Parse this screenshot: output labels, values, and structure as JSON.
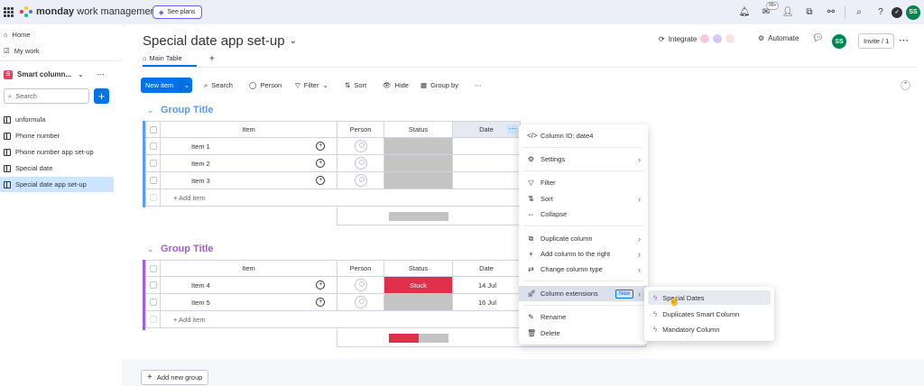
{
  "topbar": {
    "brand_bold": "monday",
    "brand_rest": " work management",
    "see_plans": "See plans",
    "notif_count": "99+",
    "user_initials": "SS"
  },
  "sidebar": {
    "home": "Home",
    "my_work": "My work",
    "workspace_initial": "S",
    "workspace_name": "Smart column...",
    "search_placeholder": "Search",
    "boards": [
      "unformula",
      "Phone number",
      "Phone number app set-up",
      "Special date",
      "Special date app set-up"
    ]
  },
  "board": {
    "title": "Special date app set-up",
    "main_tab": "Main Table",
    "integrate": "Integrate",
    "automate": "Automate",
    "invite": "Invite / 1",
    "user_initials": "SS"
  },
  "toolbar": {
    "new_item": "New item",
    "search": "Search",
    "person": "Person",
    "filter": "Filter",
    "sort": "Sort",
    "hide": "Hide",
    "group_by": "Group by"
  },
  "columns": {
    "item": "Item",
    "person": "Person",
    "status": "Status",
    "date": "Date"
  },
  "groups": [
    {
      "title": "Group Title",
      "color": "#579bfc",
      "items": [
        {
          "name": "Item 1",
          "status": "",
          "date": ""
        },
        {
          "name": "Item 2",
          "status": "",
          "date": ""
        },
        {
          "name": "Item 3",
          "status": "",
          "date": ""
        }
      ],
      "add_item": "+ Add item"
    },
    {
      "title": "Group Title",
      "color": "#a25ddc",
      "items": [
        {
          "name": "Item 4",
          "status": "Stuck",
          "date": "14 Jul"
        },
        {
          "name": "Item 5",
          "status": "",
          "date": "16 Jul"
        }
      ],
      "add_item": "+ Add item"
    }
  ],
  "column_menu": {
    "column_id": "Column ID: date4",
    "settings": "Settings",
    "filter": "Filter",
    "sort": "Sort",
    "collapse": "Collapse",
    "duplicate": "Duplicate column",
    "add_right": "Add column to the right",
    "change_type": "Change column type",
    "extensions": "Column extensions",
    "new_badge": "New",
    "rename": "Rename",
    "delete": "Delete"
  },
  "extensions_menu": [
    "Special Dates",
    "Duplicates Smart Column",
    "Mandatory Column"
  ],
  "add_new_group": "Add new group",
  "colors": {
    "accent": "#0073ea",
    "stuck": "#df2f4a",
    "group1": "#579bfc",
    "group2": "#a25ddc",
    "avatar": "#00854d"
  }
}
